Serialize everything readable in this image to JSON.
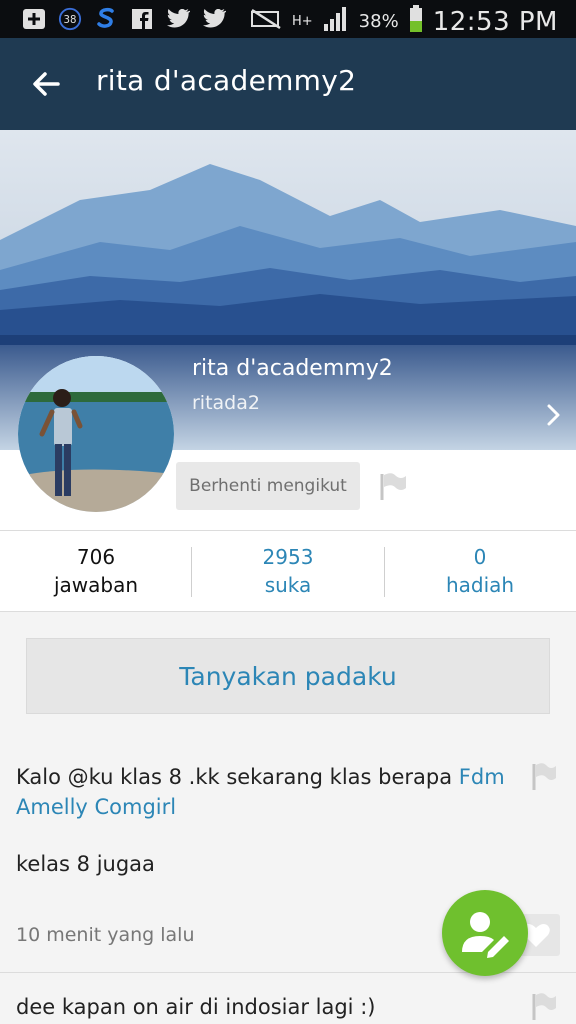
{
  "statusbar": {
    "notification_count": "38",
    "battery": "38%",
    "network": "H+",
    "time": "12:53 PM",
    "icons": [
      "add-box-icon",
      "notification-count-icon",
      "s-app-icon",
      "facebook-icon",
      "twitter-icon",
      "twitter-icon",
      "mute-icon",
      "network-icon",
      "signal-icon",
      "battery-icon"
    ]
  },
  "appbar": {
    "title": "rita d'academmy2"
  },
  "profile": {
    "display_name": "rita d'academmy2",
    "username": "ritada2",
    "unfollow_label": "Berhenti mengikut"
  },
  "stats": [
    {
      "value": "706",
      "label": "jawaban"
    },
    {
      "value": "2953",
      "label": "suka"
    },
    {
      "value": "0",
      "label": "hadiah"
    }
  ],
  "ask_button": "Tanyakan padaku",
  "feed": [
    {
      "question": "Kalo @ku klas 8 .kk sekarang klas berapa",
      "mention": "Fdm Amelly Comgirl",
      "answer": "kelas 8 jugaa",
      "time": "10 menit yang lalu"
    },
    {
      "question": "dee kapan on air di indosiar lagi :)"
    }
  ],
  "colors": {
    "appbar": "#1f3a52",
    "accent": "#2c86b6",
    "fab": "#6fc02e"
  }
}
